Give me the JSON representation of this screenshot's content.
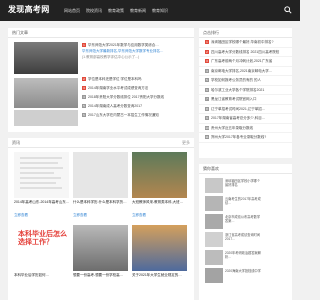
{
  "header": {
    "logo": "发现高考网",
    "nav": [
      "网站首页",
      "院校资讯",
      "教育政策",
      "教育新闻",
      "教育知识"
    ]
  },
  "hot": {
    "title": "热门文章",
    "main_title": "华东师范大学2021年数学与应用数学类综合…",
    "main_link": "华东师范大学最新排名,华东师范大学数学专业排名…",
    "main_desc": "(1.教育部高校教学评估中心公示了...)",
    "list": [
      "学位是本科还是学位 学位是本科吗",
      "2014年湖南学业水平考试成绩查询方法",
      "2018年贵阳大学分数线排位 2017贵阳大学分数线",
      "2014年湖南成人高考分数查询2017",
      "2017山东大学在内蒙古一本招生工作情况通知"
    ]
  },
  "right_list": {
    "title": "点击排行",
    "items": [
      "深圳福田区学校哪个最好,华南初中排名?",
      "四川高考大学分数线排名 2021四川高考院校",
      "广东高考前两个月冲刺计划,2021广东省",
      "南京邮电大学排名,2021南京邮电大学…",
      "学校如何报考公务员的有的 的人",
      "哈尔滨工业大学各个学院排名2021",
      "黑龙江省教育考试院官网入口",
      "辽宁单招考试时间2021,辽宁单招…",
      "2017年湖南省高考总分多少,科目…",
      "贵州大学近五年录取分数线",
      "郑州大学2017年各专业录取分数线?"
    ]
  },
  "grid": {
    "title": "资讯",
    "more": "更多",
    "cards": [
      {
        "label": "2014年高考山东-2014年高考山东…",
        "link": "立即查看"
      },
      {
        "label": "什么是本科学历-什么是本科学历…",
        "link": "立即查看"
      },
      {
        "label": "大班教师风采-教育类本科,大班…",
        "link": "立即查看"
      },
      {
        "label": "本科毕业后学历如何…",
        "link": "立即查看",
        "banner": "本科毕业后怎么\n选择工作？"
      },
      {
        "label": "想要一份高考-想要一份学校高…",
        "link": "立即查看"
      },
      {
        "label": "关于2021年大学生就业规定的…",
        "link": "立即查看"
      }
    ]
  },
  "side_news": {
    "title": "猜你喜欢",
    "items": [
      "深圳福田区学校小学哪个最好排名",
      "云南考生的2017年高考成绩…",
      "北京市成绩公布高考数学答案…",
      "浙江省高考成绩查询时间2017…",
      "2020年考研政治题答案解析…",
      "2020海南大学投档线中学"
    ]
  }
}
